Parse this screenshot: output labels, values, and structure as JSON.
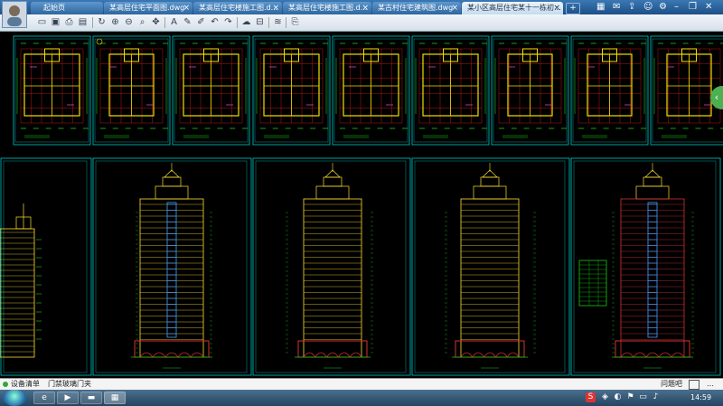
{
  "tabs": [
    {
      "label": "起始页",
      "active": false
    },
    {
      "label": "某高层住宅平面图.dwg",
      "active": false
    },
    {
      "label": "某高层住宅楼施工图.d...",
      "active": false
    },
    {
      "label": "某高层住宅楼施工图.d...",
      "active": false
    },
    {
      "label": "某古村住宅建筑图.dwg",
      "active": false
    },
    {
      "label": "某小区高层住宅某十一栋初...",
      "active": true
    }
  ],
  "tab_add_label": "+",
  "window_icons": [
    "grid-icon",
    "mail-icon",
    "share-icon",
    "user-icon",
    "settings-icon",
    "minimize-icon",
    "restore-icon",
    "close-icon"
  ],
  "toolbar_icons": [
    "open-folder-icon",
    "save-icon",
    "print-icon",
    "export-icon",
    "rotate-icon",
    "zoom-in-icon",
    "zoom-out-icon",
    "zoom-window-icon",
    "pan-icon",
    "text-icon",
    "pencil-icon",
    "pen-icon",
    "undo-icon",
    "redo-icon",
    "cloud-icon",
    "measure-icon",
    "layers-icon",
    "properties-icon"
  ],
  "scroll_button_label": "‹",
  "status": {
    "left_text": "设备清单",
    "mid_text": "门禁玻璃门夹",
    "help_text": "问题吧",
    "more_text": "…"
  },
  "taskbar": {
    "apps": [
      "explorer-icon",
      "media-icon",
      "folder-icon",
      "stack-icon",
      "cad-viewer-icon"
    ],
    "tray_icons": [
      "ime-icon",
      "network-icon",
      "volume-icon",
      "flag-icon",
      "battery-icon",
      "speaker-icon"
    ],
    "clock": "14:59"
  },
  "colors": {
    "sheet_border": "#00c8c8",
    "plan_red": "#e0201c",
    "plan_yellow": "#f0e000",
    "plan_green": "#18c818",
    "plan_magenta": "#d040d0",
    "elev_yellow": "#ffe030",
    "elev_blue": "#3f8fe8",
    "elev_red": "#d83030"
  }
}
